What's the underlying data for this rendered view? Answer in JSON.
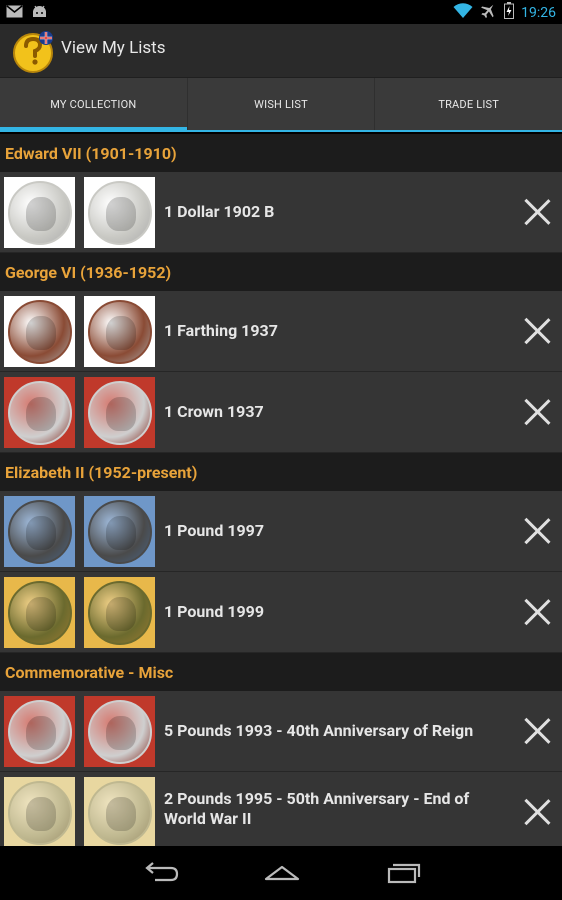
{
  "status_bar": {
    "time": "19:26",
    "icons": [
      "gmail-icon",
      "android-icon",
      "wifi-icon",
      "airplane-icon",
      "battery-icon"
    ]
  },
  "action_bar": {
    "title": "View My Lists",
    "icon": "coin-question-icon"
  },
  "tabs": [
    {
      "label": "MY COLLECTION",
      "active": true
    },
    {
      "label": "WISH LIST",
      "active": false
    },
    {
      "label": "TRADE LIST",
      "active": false
    }
  ],
  "sections": [
    {
      "title": "Edward VII (1901-1910)",
      "items": [
        {
          "name": "1 Dollar 1902 B",
          "obverse_bg": "#ffffff",
          "reverse_bg": "#ffffff",
          "coin_color": "#c9c9c4"
        }
      ]
    },
    {
      "title": "George VI (1936-1952)",
      "items": [
        {
          "name": "1 Farthing 1937",
          "obverse_bg": "#ffffff",
          "reverse_bg": "#ffffff",
          "coin_color": "#8a4b35"
        },
        {
          "name": "1 Crown 1937",
          "obverse_bg": "#c0392b",
          "reverse_bg": "#c0392b",
          "coin_color": "#cfcfcf"
        }
      ]
    },
    {
      "title": "Elizabeth II (1952-present)",
      "items": [
        {
          "name": "1 Pound 1997",
          "obverse_bg": "#6f97c8",
          "reverse_bg": "#6f97c8",
          "coin_color": "#4a4a4a"
        },
        {
          "name": "1 Pound 1999",
          "obverse_bg": "#e8b84a",
          "reverse_bg": "#e8b84a",
          "coin_color": "#6b6a2e"
        }
      ]
    },
    {
      "title": "Commemorative - Misc",
      "items": [
        {
          "name": "5 Pounds 1993 - 40th Anniversary of Reign",
          "obverse_bg": "#c0392b",
          "reverse_bg": "#c0392b",
          "coin_color": "#cfcfcf"
        },
        {
          "name": "2 Pounds 1995 - 50th Anniversary - End of World War II",
          "obverse_bg": "#e8d7a0",
          "reverse_bg": "#e8d7a0",
          "coin_color": "#bfb890"
        }
      ]
    }
  ],
  "nav_bar": {
    "buttons": [
      "back-icon",
      "home-icon",
      "recent-apps-icon"
    ]
  },
  "colors": {
    "accent": "#33b5e5",
    "section_header_text": "#e8a33a"
  }
}
